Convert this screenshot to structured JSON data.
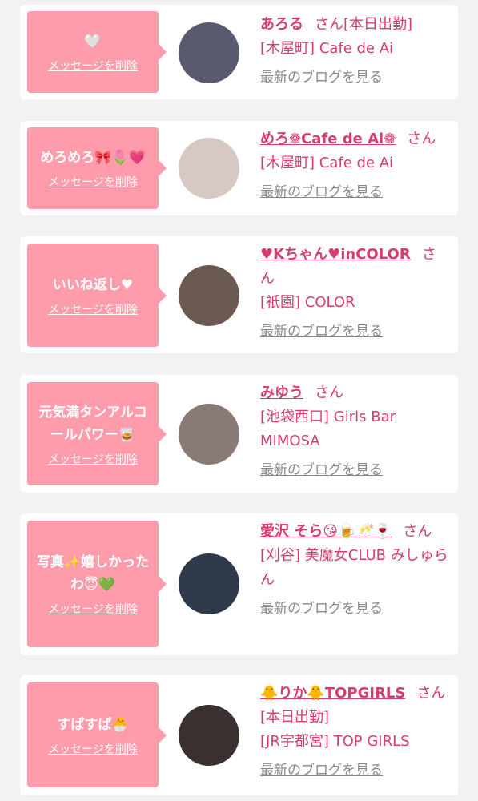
{
  "cards": [
    {
      "message": "🤍",
      "delete_label": "メッセージを削除",
      "name": "あろる",
      "san": "さん",
      "status": "[本日出勤]",
      "shop": "[木屋町] Cafe de Ai",
      "blog": "最新のブログを見る",
      "avatar_color": "#5a5a6e"
    },
    {
      "message": "めろめろ🎀🌷💗",
      "delete_label": "メッセージを削除",
      "name": "めろ❁Cafe de Ai❁",
      "san": "さん",
      "status": "",
      "shop": "[木屋町] Cafe de Ai",
      "blog": "最新のブログを見る",
      "avatar_color": "#d8c8c4"
    },
    {
      "message": "いいね返し♥",
      "delete_label": "メッセージを削除",
      "name": "♥Kちゃん♥inCOLOR",
      "san": "さん",
      "status": "",
      "shop": "[祇園] COLOR",
      "blog": "最新のブログを見る",
      "avatar_color": "#6b5a52"
    },
    {
      "message": "元気満タンアルコールパワー🥃",
      "delete_label": "メッセージを削除",
      "name": "みゆう",
      "san": "さん",
      "status": "",
      "shop": "[池袋西口] Girls Bar MIMOSA",
      "blog": "最新のブログを見る",
      "avatar_color": "#8a7a76"
    },
    {
      "message": "写真✨嬉しかったわ😇💚",
      "delete_label": "メッセージを削除",
      "name": "愛沢 そら😘🍺🥂🍷",
      "san": "さん",
      "status": "",
      "shop": "[刈谷] 美魔女CLUB みしゅらん",
      "blog": "最新のブログを見る",
      "avatar_color": "#2e3a4a"
    },
    {
      "message": "すぱすぱ🐣",
      "delete_label": "メッセージを削除",
      "name": "🐥りか🐥TOPGIRLS",
      "san": "さん",
      "status": "[本日出勤]",
      "shop": "[JR宇都宮] TOP GIRLS",
      "blog": "最新のブログを見る",
      "avatar_color": "#3a3030"
    }
  ]
}
